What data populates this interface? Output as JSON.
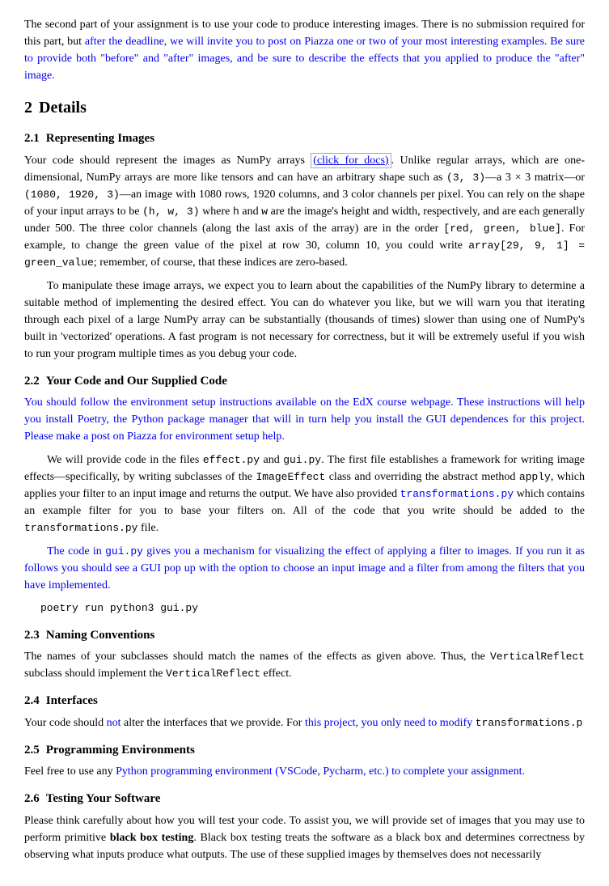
{
  "intro": {
    "text": "The second part of your assignment is to use your code to produce interesting images. There is no submission required for this part, but after the deadline, we will invite you to post on Piazza one or two of your most interesting examples. Be sure to provide both \"before\" and \"after\" images, and be sure to describe the effects that you applied to produce the \"after\" image."
  },
  "section2": {
    "number": "2",
    "title": "Details"
  },
  "section21": {
    "number": "2.1",
    "title": "Representing Images"
  },
  "section22": {
    "number": "2.2",
    "title": "Your Code and Our Supplied Code"
  },
  "section23": {
    "number": "2.3",
    "title": "Naming Conventions"
  },
  "section24": {
    "number": "2.4",
    "title": "Interfaces"
  },
  "section25": {
    "number": "2.5",
    "title": "Programming Environments"
  },
  "section26": {
    "number": "2.6",
    "title": "Testing Your Software"
  },
  "labels": {
    "click_for_docs": "(click for docs)"
  }
}
